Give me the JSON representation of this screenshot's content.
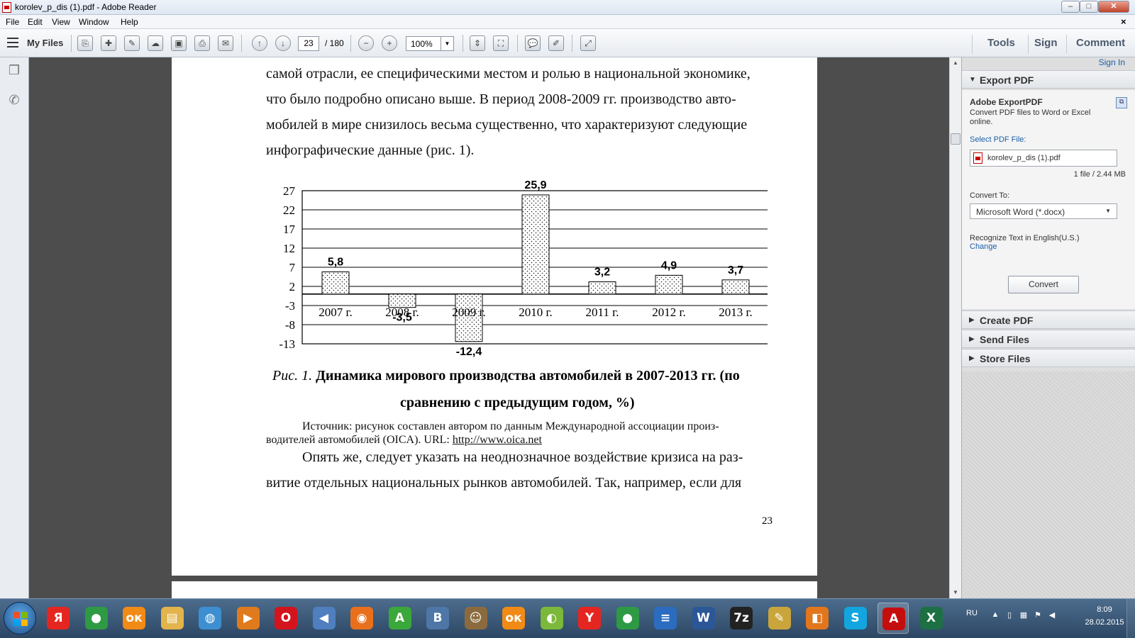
{
  "window": {
    "title": "korolev_p_dis (1).pdf - Adobe Reader",
    "controls": {
      "minimize": "–",
      "maximize": "□",
      "close": "✕",
      "doc_close": "×"
    }
  },
  "menu": [
    "File",
    "Edit",
    "View",
    "Window",
    "Help"
  ],
  "toolbar": {
    "my_files": "My Files",
    "page_current": "23",
    "page_total": "/ 180",
    "zoom": "100%",
    "tabs": [
      "Tools",
      "Sign",
      "Comment"
    ]
  },
  "document": {
    "para_top": [
      "самой отрасли, ее специфическими местом и ролью в национальной экономике,",
      "что было подробно описано выше. В период 2008-2009 гг. производство авто-",
      "мобилей в мире снизилось весьма существенно, что характеризуют следующие",
      "инфографические данные (рис. 1)."
    ],
    "caption_prefix": "Рис. 1.",
    "caption_line1": "Динамика мирового производства автомобилей в 2007-2013 гг. (по",
    "caption_line2": "сравнению с предыдущим годом, %)",
    "source_line1": "Источник: рисунок составлен автором по данным Международной ассоциации произ-",
    "source_line2": "водителей автомобилей (OICA). URL:",
    "source_link": "http://www.oica.net",
    "para_bottom": [
      "Опять же, следует указать на неоднозначное воздействие кризиса на раз-",
      "витие отдельных национальных рынков автомобилей. Так, например, если для"
    ],
    "page_number": "23"
  },
  "chart_data": {
    "type": "bar",
    "categories": [
      "2007 г.",
      "2008 г.",
      "2009 г.",
      "2010 г.",
      "2011 г.",
      "2012 г.",
      "2013 г."
    ],
    "values": [
      5.8,
      -3.5,
      -12.4,
      25.9,
      3.2,
      4.9,
      3.7
    ],
    "data_labels": [
      "5,8",
      "-3,5",
      "-12,4",
      "25,9",
      "3,2",
      "4,9",
      "3,7"
    ],
    "y_ticks": [
      27,
      22,
      17,
      12,
      7,
      2,
      -3,
      -8,
      -13
    ],
    "y_tick_labels": [
      "27",
      "22",
      "17",
      "12",
      "7",
      "2",
      "-3",
      "-8",
      "-13"
    ],
    "ylim": [
      -13,
      27
    ],
    "grid": true,
    "legend": "none",
    "bar_fill": "dotted"
  },
  "right_pane": {
    "sign_in": "Sign In",
    "export_section": "Export PDF",
    "export_title": "Adobe ExportPDF",
    "export_desc": "Convert PDF files to Word or Excel online.",
    "select_label": "Select PDF File:",
    "file_name": "korolev_p_dis (1).pdf",
    "file_size": "1 file / 2.44 MB",
    "convert_to_label": "Convert To:",
    "convert_to_value": "Microsoft Word (*.docx)",
    "recognize_text": "Recognize Text in English(U.S.)",
    "change_link": "Change",
    "convert_button": "Convert",
    "other_sections": [
      "Create PDF",
      "Send Files",
      "Store Files"
    ]
  },
  "taskbar": {
    "apps": [
      {
        "icon": "yandex-browser-icon",
        "glyph": "Я",
        "color": "#e52620"
      },
      {
        "icon": "chrome-icon",
        "glyph": "●",
        "color": "#2e9a43"
      },
      {
        "icon": "odnoklassniki-icon",
        "glyph": "ок",
        "color": "#f28a16"
      },
      {
        "icon": "folder-icon",
        "glyph": "▤",
        "color": "#e2b44b"
      },
      {
        "icon": "network-globe-icon",
        "glyph": "◍",
        "color": "#3d8fd1"
      },
      {
        "icon": "media-player-icon",
        "glyph": "▶",
        "color": "#e07a1c"
      },
      {
        "icon": "opera-icon",
        "glyph": "O",
        "color": "#d4141c"
      },
      {
        "icon": "volume-app-icon",
        "glyph": "◀",
        "color": "#4f7fbf"
      },
      {
        "icon": "firefox-icon",
        "glyph": "◉",
        "color": "#e8701c"
      },
      {
        "icon": "green-a-app-icon",
        "glyph": "A",
        "color": "#3aa83a"
      },
      {
        "icon": "vkontakte-icon",
        "glyph": "B",
        "color": "#4e76a6"
      },
      {
        "icon": "scholar-app-icon",
        "glyph": "☺",
        "color": "#8b6b3e"
      },
      {
        "icon": "odnoklassniki-icon-2",
        "glyph": "ок",
        "color": "#f28a16"
      },
      {
        "icon": "green-disc-app-icon",
        "glyph": "◐",
        "color": "#7cb83a"
      },
      {
        "icon": "yandex-icon",
        "glyph": "Y",
        "color": "#e52620"
      },
      {
        "icon": "chrome-icon-2",
        "glyph": "●",
        "color": "#2e9a43"
      },
      {
        "icon": "txt-ru-icon",
        "glyph": "≡",
        "color": "#2b6cc0"
      },
      {
        "icon": "word-icon",
        "glyph": "W",
        "color": "#2b5797"
      },
      {
        "icon": "7zip-icon",
        "glyph": "7z",
        "color": "#222222"
      },
      {
        "icon": "paint-icon",
        "glyph": "✎",
        "color": "#c9a53b"
      },
      {
        "icon": "office-icon",
        "glyph": "◧",
        "color": "#e2761c"
      },
      {
        "icon": "skype-icon",
        "glyph": "S",
        "color": "#12a5e0"
      },
      {
        "icon": "adobe-reader-icon",
        "glyph": "A",
        "color": "#c40e0e"
      },
      {
        "icon": "excel-icon",
        "glyph": "X",
        "color": "#1d7044"
      }
    ],
    "tray": {
      "language": "RU",
      "time": "8:09",
      "date": "28.02.2015"
    }
  }
}
